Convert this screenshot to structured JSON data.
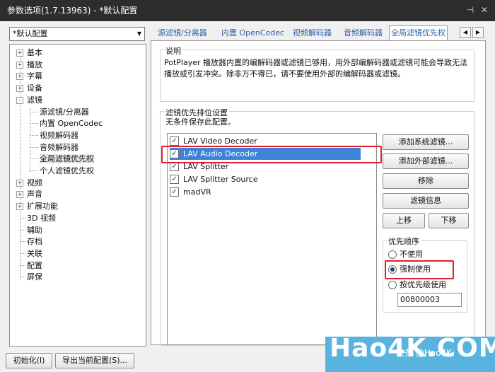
{
  "title": "参数选项(1.7.13963) - *默认配置",
  "preset": "*默认配置",
  "tree": [
    {
      "label": "基本",
      "expander": "+"
    },
    {
      "label": "播放",
      "expander": "+"
    },
    {
      "label": "字幕",
      "expander": "+"
    },
    {
      "label": "设备",
      "expander": "+"
    },
    {
      "label": "滤镜",
      "expander": "-"
    },
    {
      "label": "源滤镜/分离器",
      "child": true
    },
    {
      "label": "内置 OpenCodec",
      "child": true
    },
    {
      "label": "视频解码器",
      "child": true
    },
    {
      "label": "音频解码器",
      "child": true
    },
    {
      "label": "全局滤镜优先权",
      "child": true,
      "selected": true
    },
    {
      "label": "个人滤镜优先权",
      "child": true
    },
    {
      "label": "视频",
      "expander": "+"
    },
    {
      "label": "声音",
      "expander": "+"
    },
    {
      "label": "扩展功能",
      "expander": "+"
    },
    {
      "label": "3D 视频"
    },
    {
      "label": "辅助"
    },
    {
      "label": "存档"
    },
    {
      "label": "关联"
    },
    {
      "label": "配置"
    },
    {
      "label": "屏保"
    }
  ],
  "tabs": [
    "源滤镜/分离器",
    "内置 OpenCodec",
    "视频解码器",
    "音频解码器",
    "全局滤镜优先权"
  ],
  "description": {
    "legend": "说明",
    "line1": "PotPlayer 播放器内置的编解码器或滤镜已够用，用外部编解码器或滤镜可能会导致无法",
    "line2": "播放或引发冲突。除非万不得已，请不要使用外部的编解码器或滤镜。"
  },
  "priority": {
    "legend": "滤镜优先排位设置",
    "note": "无条件保存此配置。",
    "filters": [
      {
        "label": "LAV Video Decoder",
        "checked": "✓"
      },
      {
        "label": "LAV Audio Decoder",
        "checked": "✓"
      },
      {
        "label": "LAV Splitter",
        "checked": "✓"
      },
      {
        "label": "LAV Splitter Source",
        "checked": "✓"
      },
      {
        "label": "madVR",
        "checked": "✓"
      }
    ],
    "buttons": {
      "add_system": "添加系统滤镜...",
      "add_external": "添加外部滤镜...",
      "remove": "移除",
      "info": "滤镜信息",
      "up": "上移",
      "down": "下移"
    },
    "order": {
      "legend": "优先顺序",
      "options": [
        "不使用",
        "强制使用",
        "按优先级使用"
      ],
      "selected": "强制使用",
      "value": "00800003"
    }
  },
  "bottom": {
    "init": "初始化(I)",
    "export": "导出当前配置(S)..."
  },
  "watermark": {
    "brand": "Hao4K.COM",
    "sub": "头条 @Hao4K"
  },
  "colors": {
    "selection": "#3d83d8",
    "highlight": "#e0202a",
    "titlebar": "#2d2d2d"
  }
}
